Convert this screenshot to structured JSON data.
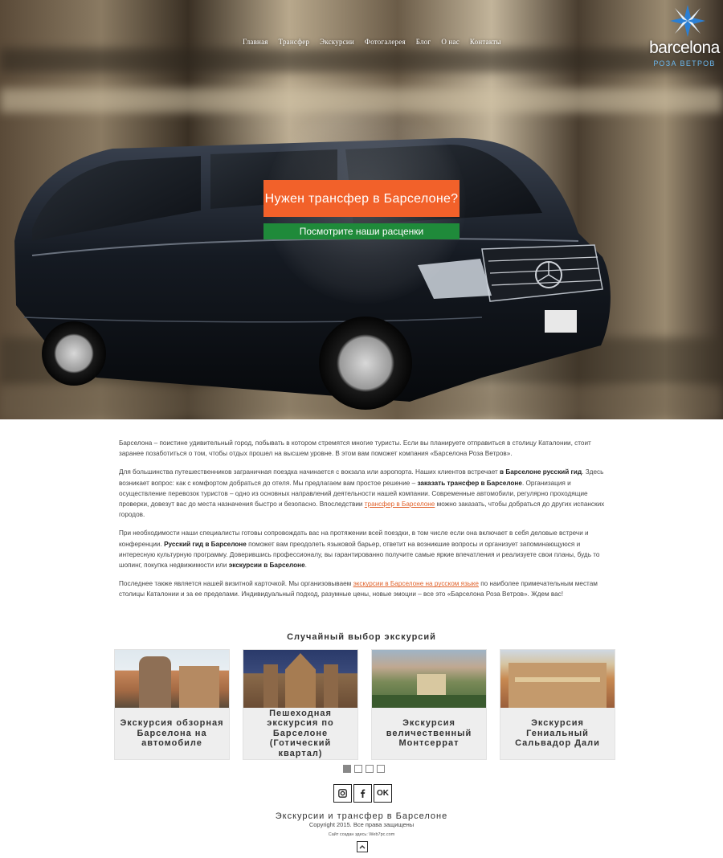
{
  "nav": {
    "items": [
      "Главная",
      "Трансфер",
      "Экскурсии",
      "Фотогалерея",
      "Блог",
      "О нас",
      "Контакты"
    ]
  },
  "logo": {
    "word": "barcelona",
    "sub": "РОЗА ВЕТРОВ"
  },
  "hero": {
    "headline": "Нужен трансфер в Барселоне?",
    "cta": "Посмотрите наши расценки"
  },
  "content": {
    "p1": "Барселона – поистине удивительный город, побывать в котором стремятся многие туристы. Если вы планируете отправиться в столицу Каталонии, стоит заранее позаботиться о том, чтобы отдых прошел на высшем уровне. В этом вам поможет компания «Барселона Роза Ветров».",
    "p2_a": "Для большинства путешественников заграничная поездка начинается с вокзала или аэропорта. Наших клиентов встречает ",
    "p2_b": "в Барселоне русский гид",
    "p2_c": ". Здесь возникает вопрос: как с комфортом добраться до отеля. Мы предлагаем вам простое решение – ",
    "p2_d": "заказать трансфер в Барселоне",
    "p2_e": ". Организация и осуществление перевозок туристов – одно из основных направлений деятельности нашей компании. Современные автомобили, регулярно проходящие проверки, довезут вас до места назначения быстро и безопасно. Впоследствии ",
    "p2_link": "трансфер в Барселоне",
    "p2_f": " можно заказать, чтобы добраться до других испанских городов.",
    "p3_a": "При необходимости наши специалисты готовы сопровождать вас на протяжении всей поездки, в том числе если она включает в себя деловые встречи и конференции. ",
    "p3_b": "Русский гид в Барселоне",
    "p3_c": " поможет вам преодолеть языковой барьер, ответит на возникшие вопросы и организует запоминающуюся и интересную культурную программу. Доверившись профессионалу, вы гарантированно получите самые яркие впечатления и реализуете свои планы, будь то шопинг, покупка недвижимости или ",
    "p3_d": "экскурсии в Барселоне",
    "p3_e": ".",
    "p4_a": "Последнее также является нашей визитной карточкой. Мы организовываем ",
    "p4_link": "экскурсии в Барселоне на русском языке",
    "p4_b": " по наиболее примечательным местам столицы Каталонии и за ее пределами. Индивидуальный подход, разумные цены, новые эмоции – все это «Барселона Роза Ветров». Ждем вас!"
  },
  "excursions": {
    "title": "Случайный выбор экскурсий",
    "cards": [
      {
        "title": "Экскурсия обзорная Барселона на автомобиле"
      },
      {
        "title": "Пешеходная экскурсия по Барселоне (Готический квартал)"
      },
      {
        "title": "Экскурсия величественный Монтсеррат"
      },
      {
        "title": "Экскурсия Гениальный Сальвадор Дали"
      }
    ]
  },
  "social": {
    "ok_label": "OK"
  },
  "footer": {
    "title": "Экскурсии и трансфер в Барселоне",
    "copyright": "Copyright 2015. Все права защищены",
    "made": "Сайт создан здесь: Web7pc.com"
  },
  "colors": {
    "accent_orange": "#f2612a",
    "accent_green": "#1f8a3a",
    "logo_blue": "#6bb8ef"
  }
}
